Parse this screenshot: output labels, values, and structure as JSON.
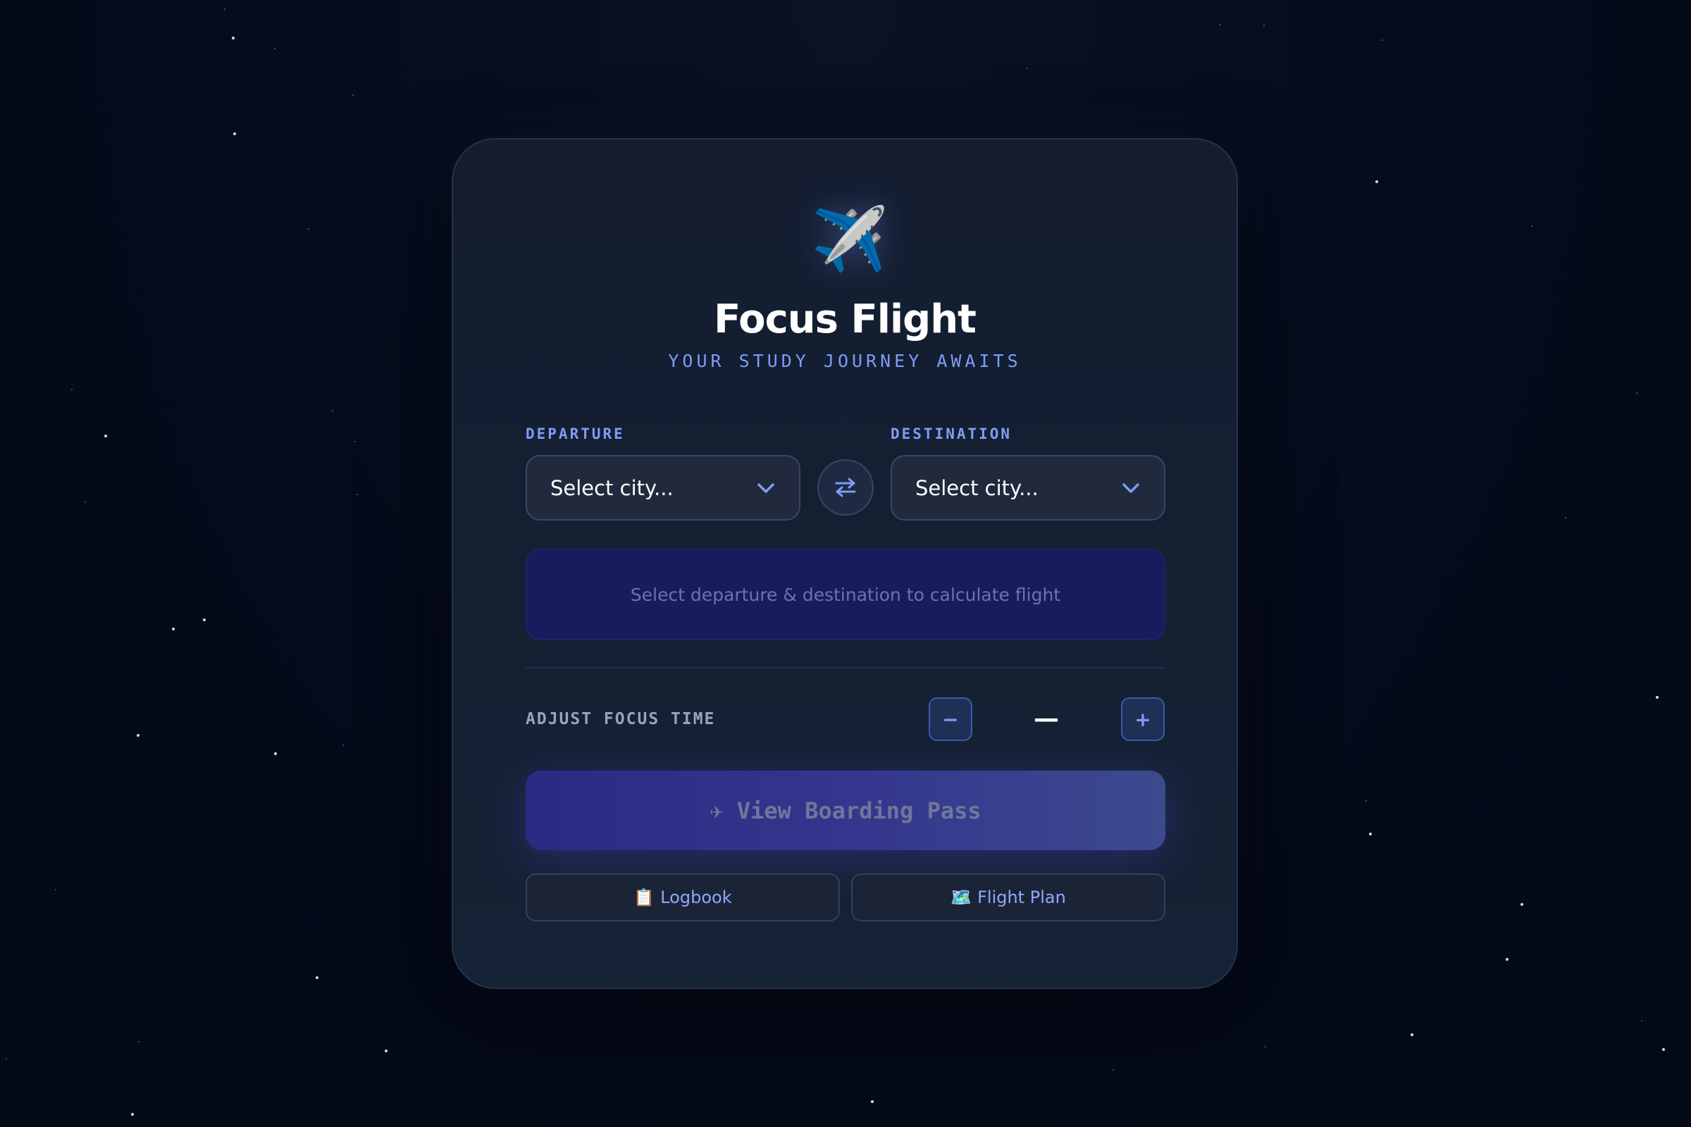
{
  "app": {
    "plane_icon": "✈️",
    "title": "Focus Flight",
    "subtitle": "YOUR STUDY JOURNEY AWAITS"
  },
  "route": {
    "departure_label": "DEPARTURE",
    "departure_value": "Select city...",
    "destination_label": "DESTINATION",
    "destination_value": "Select city...",
    "swap_icon": "swap-arrows-icon",
    "chevron_icon": "chevron-down-icon"
  },
  "info": {
    "message": "Select departure & destination to calculate flight"
  },
  "focus": {
    "label": "ADJUST FOCUS TIME",
    "minus_label": "−",
    "plus_label": "+",
    "value": "—"
  },
  "actions": {
    "boarding_pass_label": "✈ View Boarding Pass",
    "logbook_emoji": "📋",
    "logbook_label": "Logbook",
    "flight_plan_emoji": "🗺️",
    "flight_plan_label": "Flight Plan"
  },
  "colors": {
    "accent": "#7f9cf5",
    "background": "#050b1a",
    "card": "#151f33",
    "info_box": "#191c5c",
    "primary_button": "#2f318a"
  }
}
